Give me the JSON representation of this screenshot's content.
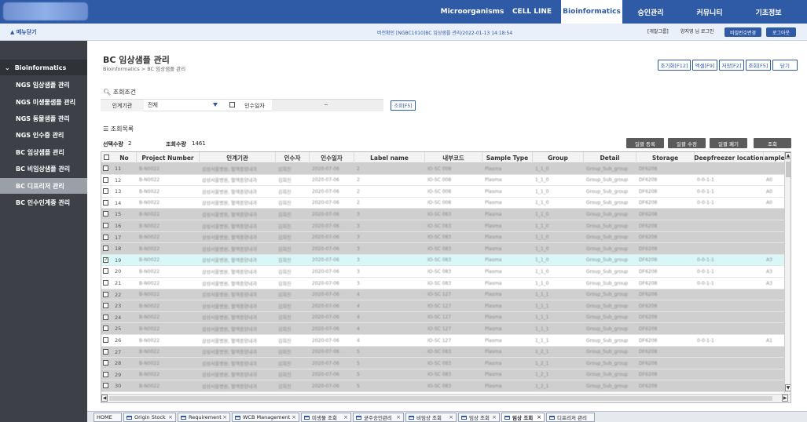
{
  "topnav": [
    {
      "label": "Microorganisms"
    },
    {
      "label": "CELL LINE"
    },
    {
      "label": "Bioinformatics"
    },
    {
      "label": "승인관리"
    },
    {
      "label": "커뮤니티"
    },
    {
      "label": "기초정보"
    }
  ],
  "subbar": {
    "menu_toggle": "▲ 메뉴닫기",
    "info": "버전확인 [NGBC1010]BC 임상샘플 관리/2022-01-13 14:18:54",
    "dev_group": "[개발그룹]",
    "user_login": "양지영 님 로그인",
    "change_pw": "비밀번호변경",
    "logout": "로그아웃"
  },
  "sidebar": {
    "header": "Bioinformatics",
    "items": [
      {
        "label": "NGS 임상샘플 관리"
      },
      {
        "label": "NGS 미생물샘플 관리"
      },
      {
        "label": "NGS 동물샘플 관리"
      },
      {
        "label": "NGS 인수증 관리"
      },
      {
        "label": "BC 임상샘플 관리"
      },
      {
        "label": "BC 비임상샘플 관리"
      },
      {
        "label": "BC 디프리저 관리"
      },
      {
        "label": "BC 인수인계증 관리"
      }
    ]
  },
  "page": {
    "title": "BC 임상샘플 관리",
    "breadcrumb": "Bioinformatics > BC 임상샘플 관리",
    "toolbar": [
      "조기화[F12]",
      "엑셀[F9]",
      "저장[F2]",
      "조회[F5]",
      "닫기"
    ]
  },
  "search": {
    "section_title": "조회조건",
    "org_label": "인계기관",
    "org_value": "전체",
    "date_label": "인수일자",
    "date_sep": "~",
    "query_button": "조회[F5]"
  },
  "list": {
    "section_title": "조회목록",
    "selected_label": "선택수량",
    "selected_count": "2",
    "query_label": "조회수량",
    "query_count": "1461",
    "buttons": [
      "일괄 등록",
      "일괄 수정",
      "일괄 폐기",
      "조회"
    ]
  },
  "grid": {
    "columns": [
      "No",
      "Project Number",
      "인계기관",
      "인수자",
      "인수일자",
      "Label name",
      "내부코드",
      "Sample Type",
      "Group",
      "Detail",
      "Storage",
      "Deepfreezer location",
      "Sample l"
    ],
    "rows": [
      {
        "no": "11",
        "style": "gray",
        "checked": false,
        "cells": [
          "B-N0022",
          "삼성서울병원, 혈액종양내과",
          "김희진",
          "2020-07-06",
          "2",
          "IO-SC 008",
          "Plasma",
          "1_1_0",
          "Group_Sub_group",
          "DF6208",
          "",
          ""
        ]
      },
      {
        "no": "12",
        "style": "white",
        "checked": false,
        "cells": [
          "B-N0022",
          "삼성서울병원, 혈액종양내과",
          "김희진",
          "2020-07-06",
          "2",
          "IO-SC 008",
          "Plasma",
          "1_1_0",
          "Group_Sub_group",
          "DF6208",
          "0-0-1-1",
          "A0"
        ]
      },
      {
        "no": "13",
        "style": "white",
        "checked": false,
        "cells": [
          "B-N0022",
          "삼성서울병원, 혈액종양내과",
          "김희진",
          "2020-07-06",
          "2",
          "IO-SC 008",
          "Plasma",
          "1_1_0",
          "Group_Sub_group",
          "DF6208",
          "0-0-1-1",
          "A0"
        ]
      },
      {
        "no": "14",
        "style": "white",
        "checked": false,
        "cells": [
          "B-N0022",
          "삼성서울병원, 혈액종양내과",
          "김희진",
          "2020-07-06",
          "2",
          "IO-SC 008",
          "Plasma",
          "1_1_0",
          "Group_Sub_group",
          "DF6208",
          "0-0-1-1",
          "A0"
        ]
      },
      {
        "no": "15",
        "style": "gray",
        "checked": false,
        "cells": [
          "B-N0022",
          "삼성서울병원, 혈액종양내과",
          "김희진",
          "2020-07-06",
          "3",
          "IO-SC 083",
          "Plasma",
          "1_1_0",
          "Group_Sub_group",
          "DF6208",
          "",
          ""
        ]
      },
      {
        "no": "16",
        "style": "gray",
        "checked": false,
        "cells": [
          "B-N0022",
          "삼성서울병원, 혈액종양내과",
          "김희진",
          "2020-07-06",
          "3",
          "IO-SC 083",
          "Plasma",
          "1_1_0",
          "Group_Sub_group",
          "DF6208",
          "",
          ""
        ]
      },
      {
        "no": "17",
        "style": "gray",
        "checked": false,
        "cells": [
          "B-N0022",
          "삼성서울병원, 혈액종양내과",
          "김희진",
          "2020-07-06",
          "3",
          "IO-SC 083",
          "Plasma",
          "1_1_0",
          "Group_Sub_group",
          "DF6208",
          "",
          ""
        ]
      },
      {
        "no": "18",
        "style": "gray",
        "checked": false,
        "cells": [
          "B-N0022",
          "삼성서울병원, 혈액종양내과",
          "김희진",
          "2020-07-06",
          "3",
          "IO-SC 083",
          "Plasma",
          "1_1_0",
          "Group_Sub_group",
          "DF6208",
          "",
          ""
        ]
      },
      {
        "no": "19",
        "style": "sel",
        "checked": true,
        "cells": [
          "B-N0022",
          "삼성서울병원, 혈액종양내과",
          "김희진",
          "2020-07-06",
          "3",
          "IO-SC 083",
          "Plasma",
          "1_1_0",
          "Group_Sub_group",
          "DF6208",
          "0-0-1-1",
          "A3"
        ]
      },
      {
        "no": "20",
        "style": "white",
        "checked": false,
        "cells": [
          "B-N0022",
          "삼성서울병원, 혈액종양내과",
          "김희진",
          "2020-07-06",
          "3",
          "IO-SC 083",
          "Plasma",
          "1_1_0",
          "Group_Sub_group",
          "DF6208",
          "0-0-1-1",
          "A3"
        ]
      },
      {
        "no": "21",
        "style": "white",
        "checked": false,
        "cells": [
          "B-N0022",
          "삼성서울병원, 혈액종양내과",
          "김희진",
          "2020-07-06",
          "3",
          "IO-SC 083",
          "Plasma",
          "1_1_0",
          "Group_Sub_group",
          "DF6208",
          "0-0-1-1",
          "A3"
        ]
      },
      {
        "no": "22",
        "style": "gray",
        "checked": false,
        "cells": [
          "B-N0022",
          "삼성서울병원, 혈액종양내과",
          "김희진",
          "2020-07-06",
          "4",
          "IO-SC 127",
          "Plasma",
          "1_1_1",
          "Group_Sub_group",
          "DF6208",
          "",
          ""
        ]
      },
      {
        "no": "23",
        "style": "gray",
        "checked": false,
        "cells": [
          "B-N0022",
          "삼성서울병원, 혈액종양내과",
          "김희진",
          "2020-07-06",
          "4",
          "IO-SC 127",
          "Plasma",
          "1_1_1",
          "Group_Sub_group",
          "DF6208",
          "",
          ""
        ]
      },
      {
        "no": "24",
        "style": "gray",
        "checked": false,
        "cells": [
          "B-N0022",
          "삼성서울병원, 혈액종양내과",
          "김희진",
          "2020-07-06",
          "4",
          "IO-SC 127",
          "Plasma",
          "1_1_1",
          "Group_Sub_group",
          "DF6208",
          "",
          ""
        ]
      },
      {
        "no": "25",
        "style": "gray",
        "checked": false,
        "cells": [
          "B-N0022",
          "삼성서울병원, 혈액종양내과",
          "김희진",
          "2020-07-06",
          "4",
          "IO-SC 127",
          "Plasma",
          "1_1_1",
          "Group_Sub_group",
          "DF6208",
          "",
          ""
        ]
      },
      {
        "no": "26",
        "style": "white",
        "checked": false,
        "cells": [
          "B-N0022",
          "삼성서울병원, 혈액종양내과",
          "김희진",
          "2020-07-06",
          "4",
          "IO-SC 127",
          "Plasma",
          "1_1_1",
          "Group_Sub_group",
          "DF6208",
          "0-0-1-1",
          "A1"
        ]
      },
      {
        "no": "27",
        "style": "gray",
        "checked": false,
        "cells": [
          "B-N0022",
          "삼성서울병원, 혈액종양내과",
          "김희진",
          "2020-07-06",
          "5",
          "IO-SC 083",
          "Plasma",
          "1_2_1",
          "Group_Sub_group",
          "DF6208",
          "",
          ""
        ]
      },
      {
        "no": "28",
        "style": "gray",
        "checked": false,
        "cells": [
          "B-N0022",
          "삼성서울병원, 혈액종양내과",
          "김희진",
          "2020-07-06",
          "5",
          "IO-SC 083",
          "Plasma",
          "1_2_1",
          "Group_Sub_group",
          "DF6208",
          "",
          ""
        ]
      },
      {
        "no": "29",
        "style": "gray",
        "checked": false,
        "cells": [
          "B-N0022",
          "삼성서울병원, 혈액종양내과",
          "김희진",
          "2020-07-06",
          "5",
          "IO-SC 083",
          "Plasma",
          "1_2_1",
          "Group_Sub_group",
          "DF6208",
          "",
          ""
        ]
      },
      {
        "no": "30",
        "style": "gray",
        "checked": false,
        "cells": [
          "B-N0022",
          "삼성서울병원, 혈액종양내과",
          "김희진",
          "2020-07-06",
          "5",
          "IO-SC 083",
          "Plasma",
          "1_2_1",
          "Group_Sub_group",
          "DF6208",
          "",
          ""
        ]
      }
    ]
  },
  "bottom_tabs": [
    {
      "label": "HOME",
      "icon": false,
      "close": false,
      "active": false
    },
    {
      "label": "Origin Stock",
      "icon": true,
      "close": true,
      "active": false
    },
    {
      "label": "Requirement",
      "icon": true,
      "close": true,
      "active": false
    },
    {
      "label": "WCB Management",
      "icon": true,
      "close": true,
      "active": false
    },
    {
      "label": "미생물 조회",
      "icon": true,
      "close": true,
      "active": false
    },
    {
      "label": "균주승인관리",
      "icon": true,
      "close": true,
      "active": false
    },
    {
      "label": "비임상 조회",
      "icon": true,
      "close": true,
      "active": false
    },
    {
      "label": "임상 조회",
      "icon": true,
      "close": true,
      "active": false
    },
    {
      "label": "임상 조회",
      "icon": true,
      "close": true,
      "active": true
    },
    {
      "label": "디프리저 관리",
      "icon": true,
      "close": false,
      "active": false
    }
  ],
  "colors": {
    "brand": "#2f5aa6",
    "sidebar": "#3d4147",
    "selected_row": "#d9f7f7",
    "gray_row": "#cfcfcf"
  }
}
